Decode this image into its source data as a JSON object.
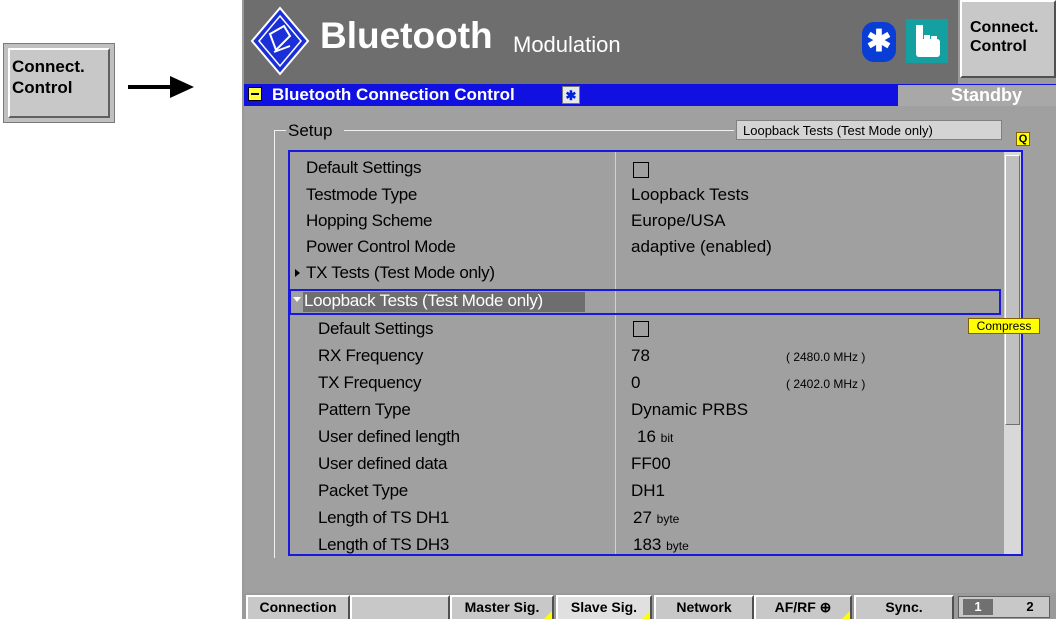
{
  "side_button": {
    "line1": "Connect.",
    "line2": "Control"
  },
  "header": {
    "title": "Bluetooth",
    "subtitle": "Modulation",
    "bt_glyph": "✱",
    "right_button": {
      "line1": "Connect.",
      "line2": "Control"
    }
  },
  "panel": {
    "title": "Bluetooth Connection Control",
    "status": "Standby",
    "group_label": "Setup",
    "context_label": "Loopback Tests (Test Mode only)",
    "q_badge": "Q",
    "compress_label": "Compress"
  },
  "rows": [
    {
      "label": "Default Settings",
      "value": "",
      "checkbox": true
    },
    {
      "label": "Testmode Type",
      "value": "Loopback Tests"
    },
    {
      "label": "Hopping Scheme",
      "value": "Europe/USA"
    },
    {
      "label": "Power Control Mode",
      "value": "adaptive (enabled)"
    },
    {
      "label": "TX Tests (Test Mode only)",
      "value": "",
      "expander": "collapsed"
    },
    {
      "label": "Loopback Tests (Test Mode only)",
      "value": "",
      "expander": "expanded",
      "selected": true
    },
    {
      "label": "Default Settings",
      "value": "",
      "checkbox": true
    },
    {
      "label": "RX Frequency",
      "value": "78",
      "extra": "( 2480.0  MHz )"
    },
    {
      "label": "TX Frequency",
      "value": "0",
      "extra": "( 2402.0  MHz )"
    },
    {
      "label": "Pattern Type",
      "value": "Dynamic PRBS"
    },
    {
      "label": "User defined length",
      "value": "16",
      "unit": "bit"
    },
    {
      "label": "User defined data",
      "value": "FF00"
    },
    {
      "label": "Packet Type",
      "value": "DH1"
    },
    {
      "label": "Length of TS DH1",
      "value": "27",
      "unit": "byte"
    },
    {
      "label": "Length of TS DH3",
      "value": "183",
      "unit": "byte"
    }
  ],
  "softkeys": [
    {
      "label": "Connection"
    },
    {
      "label": ""
    },
    {
      "label": "Master Sig."
    },
    {
      "label": "Slave Sig."
    },
    {
      "label": "Network"
    },
    {
      "label": "AF/RF ⊕"
    },
    {
      "label": "Sync."
    }
  ],
  "page_indicator": {
    "page1": "1",
    "page2": "2"
  },
  "colors": {
    "accent_blue": "#1818e0",
    "header_gray": "#6e6e6e",
    "highlight_yellow": "#ffff00"
  }
}
